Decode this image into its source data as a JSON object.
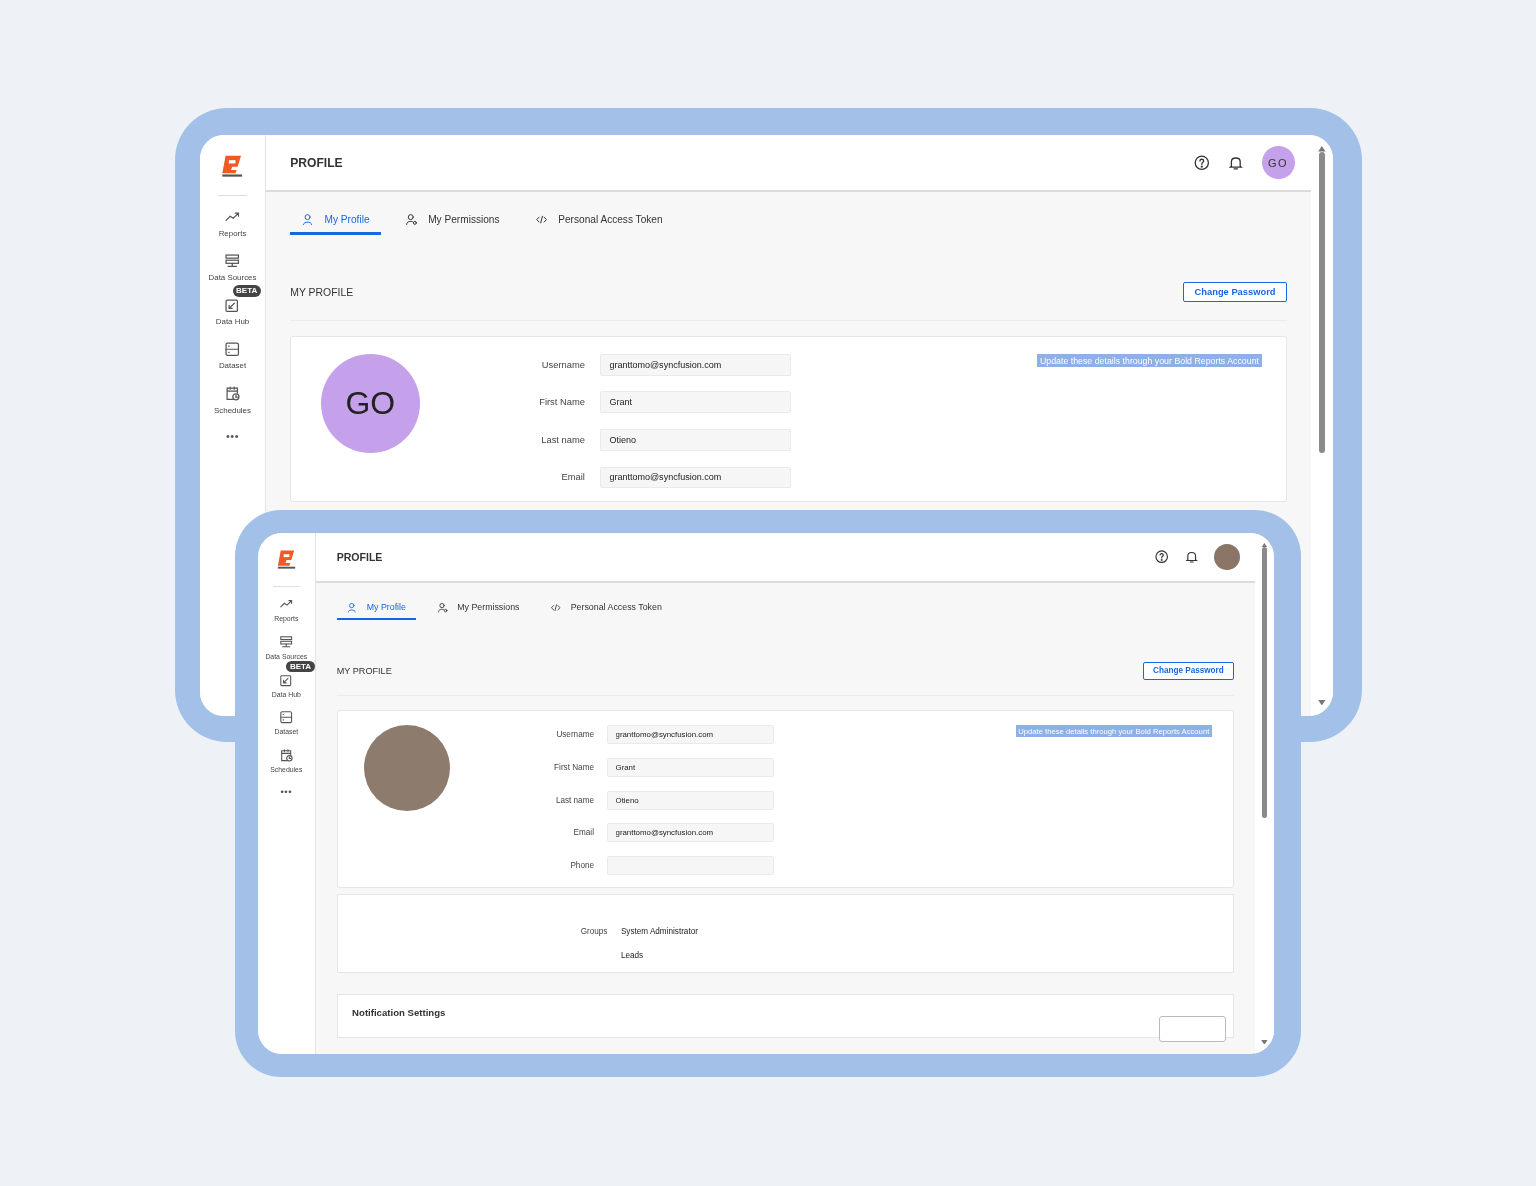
{
  "windows": [
    {
      "title": "PROFILE",
      "header_avatar": {
        "kind": "initials",
        "initials": "GO"
      },
      "sidebar": [
        {
          "kind": "nav",
          "label": "Reports"
        },
        {
          "kind": "nav",
          "label": "Data Sources"
        },
        {
          "kind": "nav",
          "label": "Data Hub",
          "badge": "BETA"
        },
        {
          "kind": "nav",
          "label": "Dataset"
        },
        {
          "kind": "nav",
          "label": "Schedules"
        },
        {
          "kind": "more",
          "label": "•••"
        }
      ],
      "tabs": [
        {
          "label": "My Profile",
          "selected": true
        },
        {
          "label": "My Permissions",
          "selected": false
        },
        {
          "label": "Personal Access Token",
          "selected": false
        }
      ],
      "section_title": "MY PROFILE",
      "button": "Change Password",
      "avatar": {
        "kind": "initials",
        "initials": "GO"
      },
      "fields": [
        {
          "label": "Username",
          "value": "granttomo@syncfusion.com"
        },
        {
          "label": "First Name",
          "value": "Grant"
        },
        {
          "label": "Last name",
          "value": "Otieno"
        },
        {
          "label": "Email",
          "value": "granttomo@syncfusion.com"
        }
      ],
      "info_note": "Update these details through your Bold Reports Account"
    },
    {
      "title": "PROFILE",
      "header_avatar": {
        "kind": "photo"
      },
      "sidebar": [
        {
          "kind": "nav",
          "label": "Reports"
        },
        {
          "kind": "nav",
          "label": "Data Sources"
        },
        {
          "kind": "nav",
          "label": "Data Hub",
          "badge": "BETA"
        },
        {
          "kind": "nav",
          "label": "Dataset"
        },
        {
          "kind": "nav",
          "label": "Schedules"
        },
        {
          "kind": "more",
          "label": "•••"
        }
      ],
      "tabs": [
        {
          "label": "My Profile",
          "selected": true
        },
        {
          "label": "My Permissions",
          "selected": false
        },
        {
          "label": "Personal Access Token",
          "selected": false
        }
      ],
      "section_title": "MY PROFILE",
      "button": "Change Password",
      "avatar": {
        "kind": "photo"
      },
      "fields": [
        {
          "label": "Username",
          "value": "granttomo@syncfusion.com"
        },
        {
          "label": "First Name",
          "value": "Grant"
        },
        {
          "label": "Last name",
          "value": "Otieno"
        },
        {
          "label": "Email",
          "value": "granttomo@syncfusion.com"
        },
        {
          "label": "Phone"
        }
      ],
      "info_note": "Update these details through your Bold Reports Account",
      "groups": {
        "label": "Groups",
        "values": [
          "System Administrator",
          "Leads"
        ]
      },
      "notification_settings": {
        "title": "Notification Settings"
      }
    }
  ]
}
